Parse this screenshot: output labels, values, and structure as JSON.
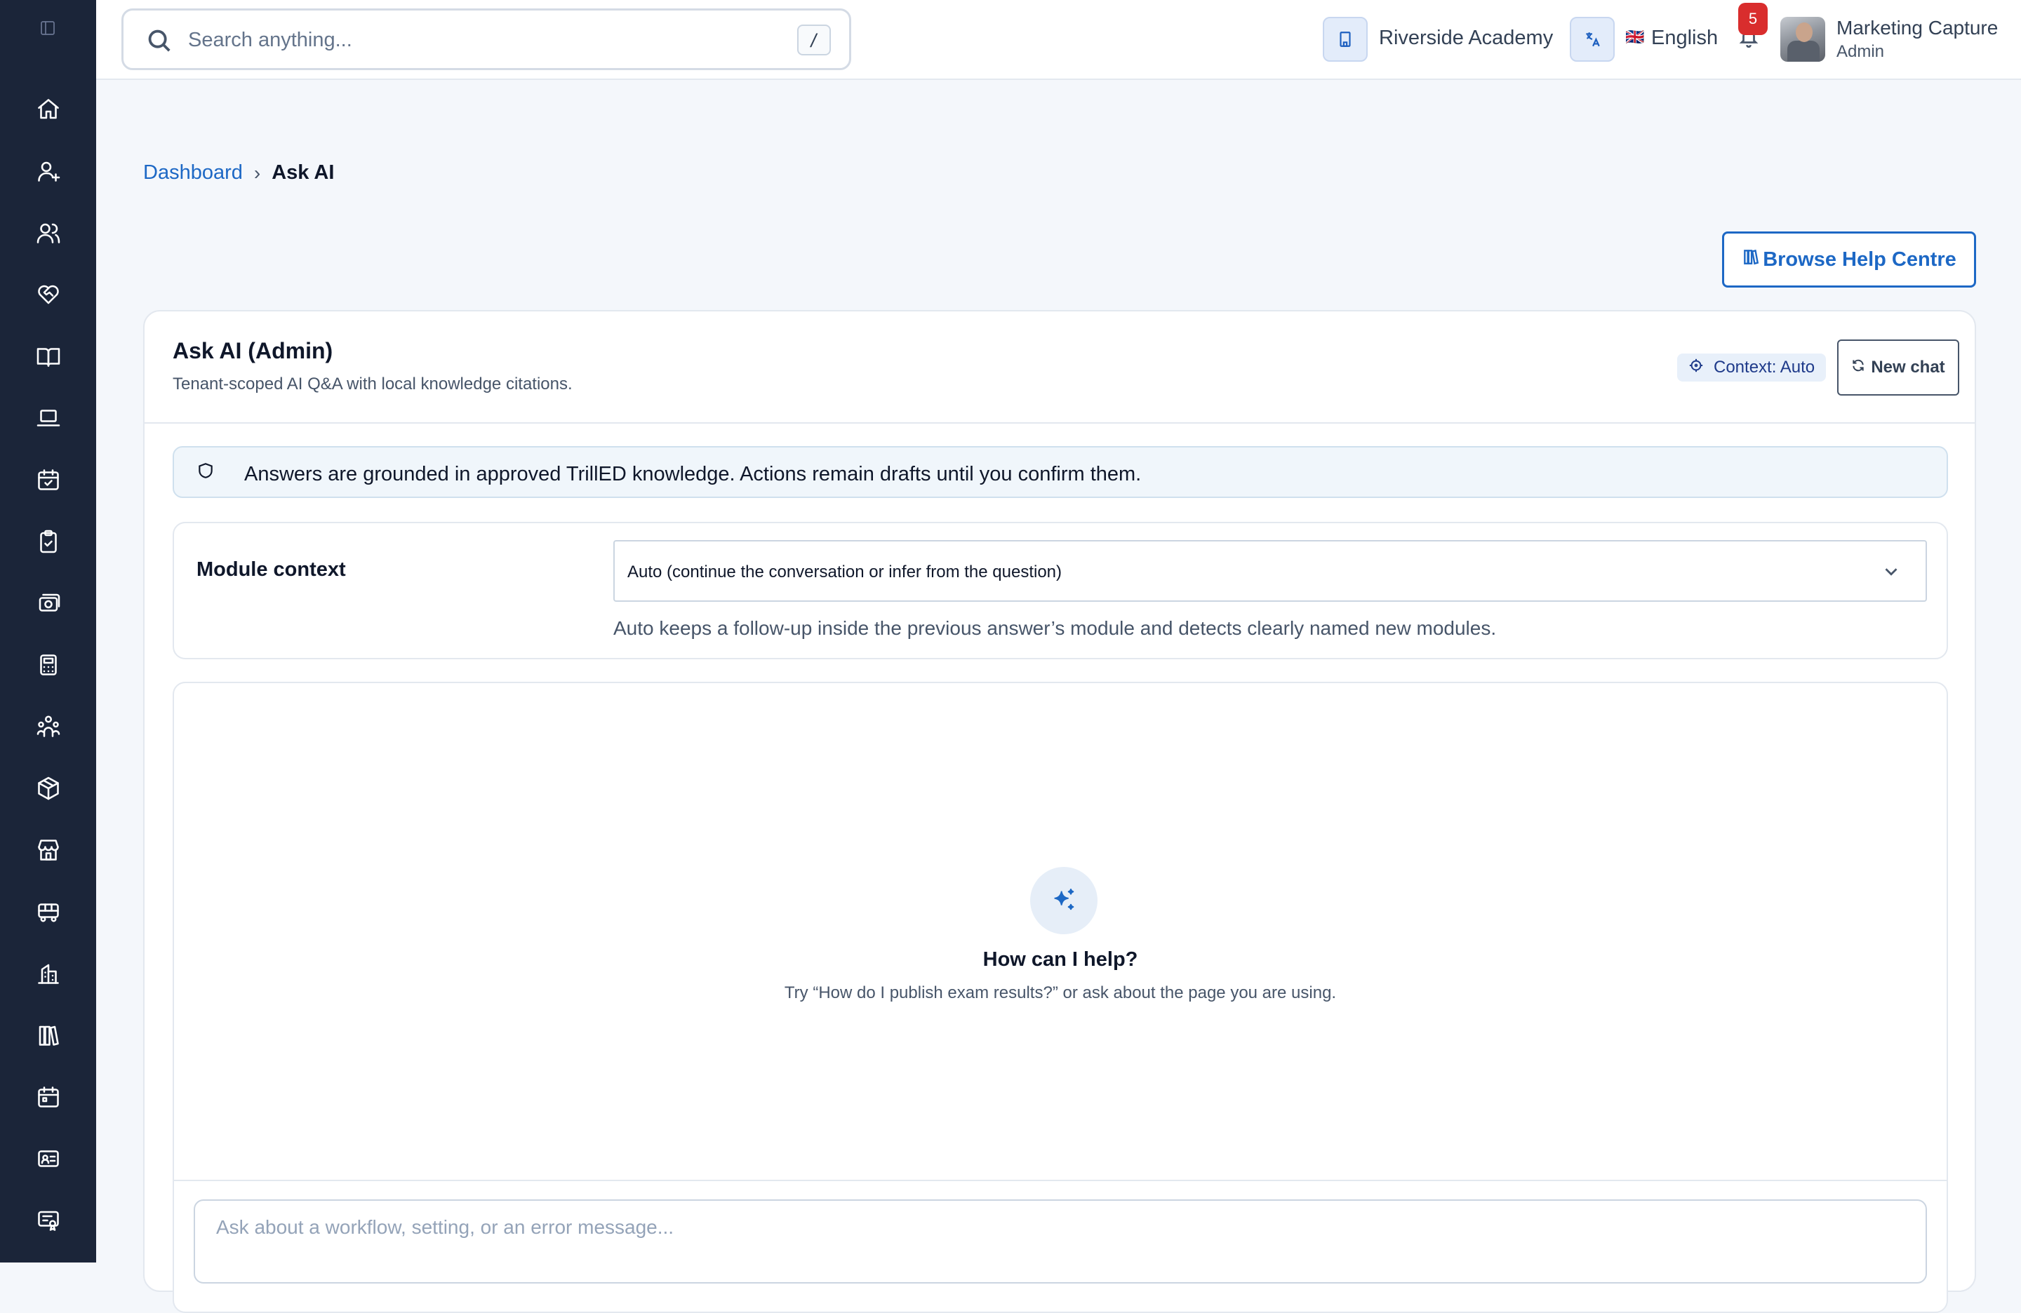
{
  "search": {
    "placeholder": "Search anything...",
    "shortcut": "/"
  },
  "header": {
    "tenant": "Riverside Academy",
    "language_flag": "🇬🇧",
    "language": "English",
    "notifications_count": "5",
    "user_name": "Marketing Capture",
    "user_role": "Admin"
  },
  "breadcrumb": {
    "parent": "Dashboard",
    "separator": "›",
    "current": "Ask AI"
  },
  "help_button": {
    "label": "Browse Help Centre"
  },
  "card": {
    "title": "Ask AI (Admin)",
    "subtitle": "Tenant-scoped AI Q&A with local knowledge citations.",
    "context_badge": "Context: Auto",
    "new_chat_label": "New chat"
  },
  "notice": {
    "text": "Answers are grounded in approved TrillED knowledge. Actions remain drafts until you confirm them."
  },
  "module_context": {
    "label": "Module context",
    "selected": "Auto (continue the conversation or infer from the question)",
    "hint": "Auto keeps a follow-up inside the previous answer’s module and detects clearly named new modules."
  },
  "empty_state": {
    "title": "How can I help?",
    "hint": "Try “How do I publish exam results?” or ask about the page you are using."
  },
  "composer": {
    "placeholder": "Ask about a workflow, setting, or an error message..."
  },
  "sidebar": {
    "items": [
      {
        "icon": "home-icon"
      },
      {
        "icon": "user-plus-icon"
      },
      {
        "icon": "users-icon"
      },
      {
        "icon": "heart-handshake-icon"
      },
      {
        "icon": "book-open-icon"
      },
      {
        "icon": "laptop-icon"
      },
      {
        "icon": "calendar-check-icon"
      },
      {
        "icon": "clipboard-check-icon"
      },
      {
        "icon": "banknote-icon"
      },
      {
        "icon": "calculator-icon"
      },
      {
        "icon": "family-icon"
      },
      {
        "icon": "package-icon"
      },
      {
        "icon": "store-icon"
      },
      {
        "icon": "bus-icon"
      },
      {
        "icon": "building-icon"
      },
      {
        "icon": "library-icon"
      },
      {
        "icon": "calendar-icon"
      },
      {
        "icon": "id-card-icon"
      },
      {
        "icon": "certificate-icon"
      }
    ]
  },
  "colors": {
    "sidebar_bg": "#1b2539",
    "accent": "#1d68c5",
    "badge_red": "#d92d2d",
    "page_bg": "#f4f7fb"
  }
}
